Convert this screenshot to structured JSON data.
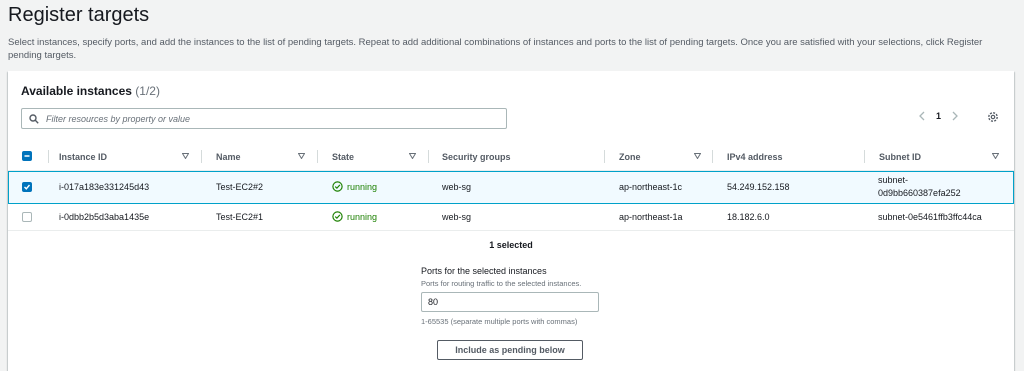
{
  "page": {
    "title": "Register targets",
    "description": "Select instances, specify ports, and add the instances to the list of pending targets. Repeat to add additional combinations of instances and ports to the list of pending targets. Once you are satisfied with your selections, click Register pending targets."
  },
  "panel": {
    "title": "Available instances",
    "count": "(1/2)",
    "search_placeholder": "Filter resources by property or value",
    "pagination": {
      "current_page": "1"
    }
  },
  "table": {
    "columns": [
      "Instance ID",
      "Name",
      "State",
      "Security groups",
      "Zone",
      "IPv4 address",
      "Subnet ID"
    ],
    "rows": [
      {
        "selected": true,
        "instance_id": "i-017a183e331245d43",
        "name": "Test-EC2#2",
        "state": "running",
        "security_group": "web-sg",
        "zone": "ap-northeast-1c",
        "ipv4": "54.249.152.158",
        "subnet_line1": "subnet-",
        "subnet_line2": "0d9bb660387efa252"
      },
      {
        "selected": false,
        "instance_id": "i-0dbb2b5d3aba1435e",
        "name": "Test-EC2#1",
        "state": "running",
        "security_group": "web-sg",
        "zone": "ap-northeast-1a",
        "ipv4": "18.182.6.0",
        "subnet_line1": "subnet-0e5461ffb3ffc44ca",
        "subnet_line2": ""
      }
    ]
  },
  "selection": {
    "summary": "1 selected",
    "ports_label": "Ports for the selected instances",
    "ports_description": "Ports for routing traffic to the selected instances.",
    "ports_value": "80",
    "ports_hint": "1-65535 (separate multiple ports with commas)",
    "include_button": "Include as pending below"
  },
  "colors": {
    "accent": "#0073bb",
    "running": "#1d8102",
    "selected_row_bg": "#f1faff",
    "selected_row_border": "#00a1c9"
  },
  "icons": [
    "search-icon",
    "chevron-left-icon",
    "chevron-right-icon",
    "gear-icon",
    "sort-caret-icon",
    "check-circle-icon"
  ]
}
